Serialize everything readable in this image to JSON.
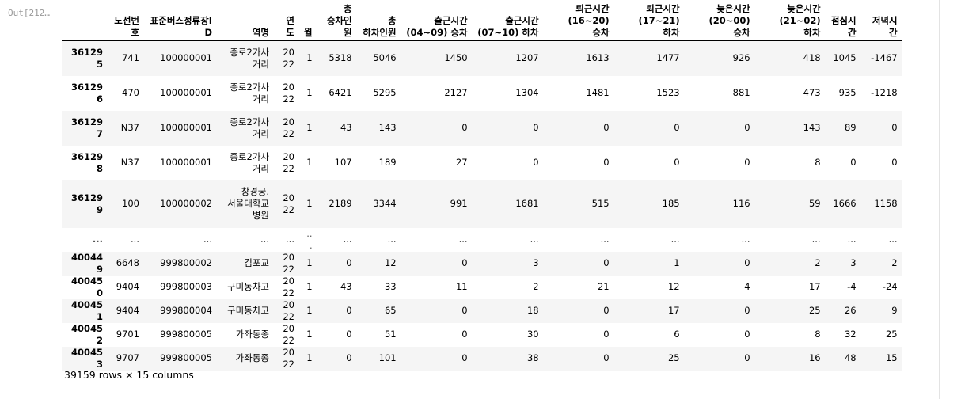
{
  "prompt": "Out[212…",
  "columns": [
    "",
    "노선번호",
    "표준버스정류장ID",
    "역명",
    "연도",
    "월",
    "총 승차인원",
    "총 하차인원",
    "출근시간 (04~09) 승차",
    "출근시간 (07~10) 하차",
    "퇴근시간 (16~20) 승차",
    "퇴근시간 (17~21) 하차",
    "늦은시간 (20~00) 승차",
    "늦은시간 (21~02) 하차",
    "점심시간",
    "저녁시간"
  ],
  "rows": [
    {
      "cells": [
        "361295",
        "741",
        "100000001",
        "종로2가사거리",
        "2022",
        "1",
        "5318",
        "5046",
        "1450",
        "1207",
        "1613",
        "1477",
        "926",
        "418",
        "1045",
        "-1467"
      ]
    },
    {
      "cells": [
        "361296",
        "470",
        "100000001",
        "종로2가사거리",
        "2022",
        "1",
        "6421",
        "5295",
        "2127",
        "1304",
        "1481",
        "1523",
        "881",
        "473",
        "935",
        "-1218"
      ]
    },
    {
      "cells": [
        "361297",
        "N37",
        "100000001",
        "종로2가사거리",
        "2022",
        "1",
        "43",
        "143",
        "0",
        "0",
        "0",
        "0",
        "0",
        "143",
        "89",
        "0"
      ]
    },
    {
      "cells": [
        "361298",
        "N37",
        "100000001",
        "종로2가사거리",
        "2022",
        "1",
        "107",
        "189",
        "27",
        "0",
        "0",
        "0",
        "0",
        "8",
        "0",
        "0"
      ]
    },
    {
      "cells": [
        "361299",
        "100",
        "100000002",
        "창경궁.서울대학교병원",
        "2022",
        "1",
        "2189",
        "3344",
        "991",
        "1681",
        "515",
        "185",
        "116",
        "59",
        "1666",
        "1158"
      ]
    },
    {
      "cells": [
        "...",
        "...",
        "...",
        "...",
        "...",
        "...",
        "...",
        "...",
        "...",
        "...",
        "...",
        "...",
        "...",
        "...",
        "...",
        "..."
      ]
    },
    {
      "cells": [
        "400449",
        "6648",
        "999800002",
        "김포교",
        "2022",
        "1",
        "0",
        "12",
        "0",
        "3",
        "0",
        "1",
        "0",
        "2",
        "3",
        "2"
      ]
    },
    {
      "cells": [
        "400450",
        "9404",
        "999800003",
        "구미동차고",
        "2022",
        "1",
        "43",
        "33",
        "11",
        "2",
        "21",
        "12",
        "4",
        "17",
        "-4",
        "-24"
      ]
    },
    {
      "cells": [
        "400451",
        "9404",
        "999800004",
        "구미동차고",
        "2022",
        "1",
        "0",
        "65",
        "0",
        "18",
        "0",
        "17",
        "0",
        "25",
        "26",
        "9"
      ]
    },
    {
      "cells": [
        "400452",
        "9701",
        "999800005",
        "가좌동종",
        "2022",
        "1",
        "0",
        "51",
        "0",
        "30",
        "0",
        "6",
        "0",
        "8",
        "32",
        "25"
      ]
    },
    {
      "cells": [
        "400453",
        "9707",
        "999800005",
        "가좌동종",
        "2022",
        "1",
        "0",
        "101",
        "0",
        "38",
        "0",
        "25",
        "0",
        "16",
        "48",
        "15"
      ]
    }
  ],
  "footer": "39159 rows × 15 columns"
}
